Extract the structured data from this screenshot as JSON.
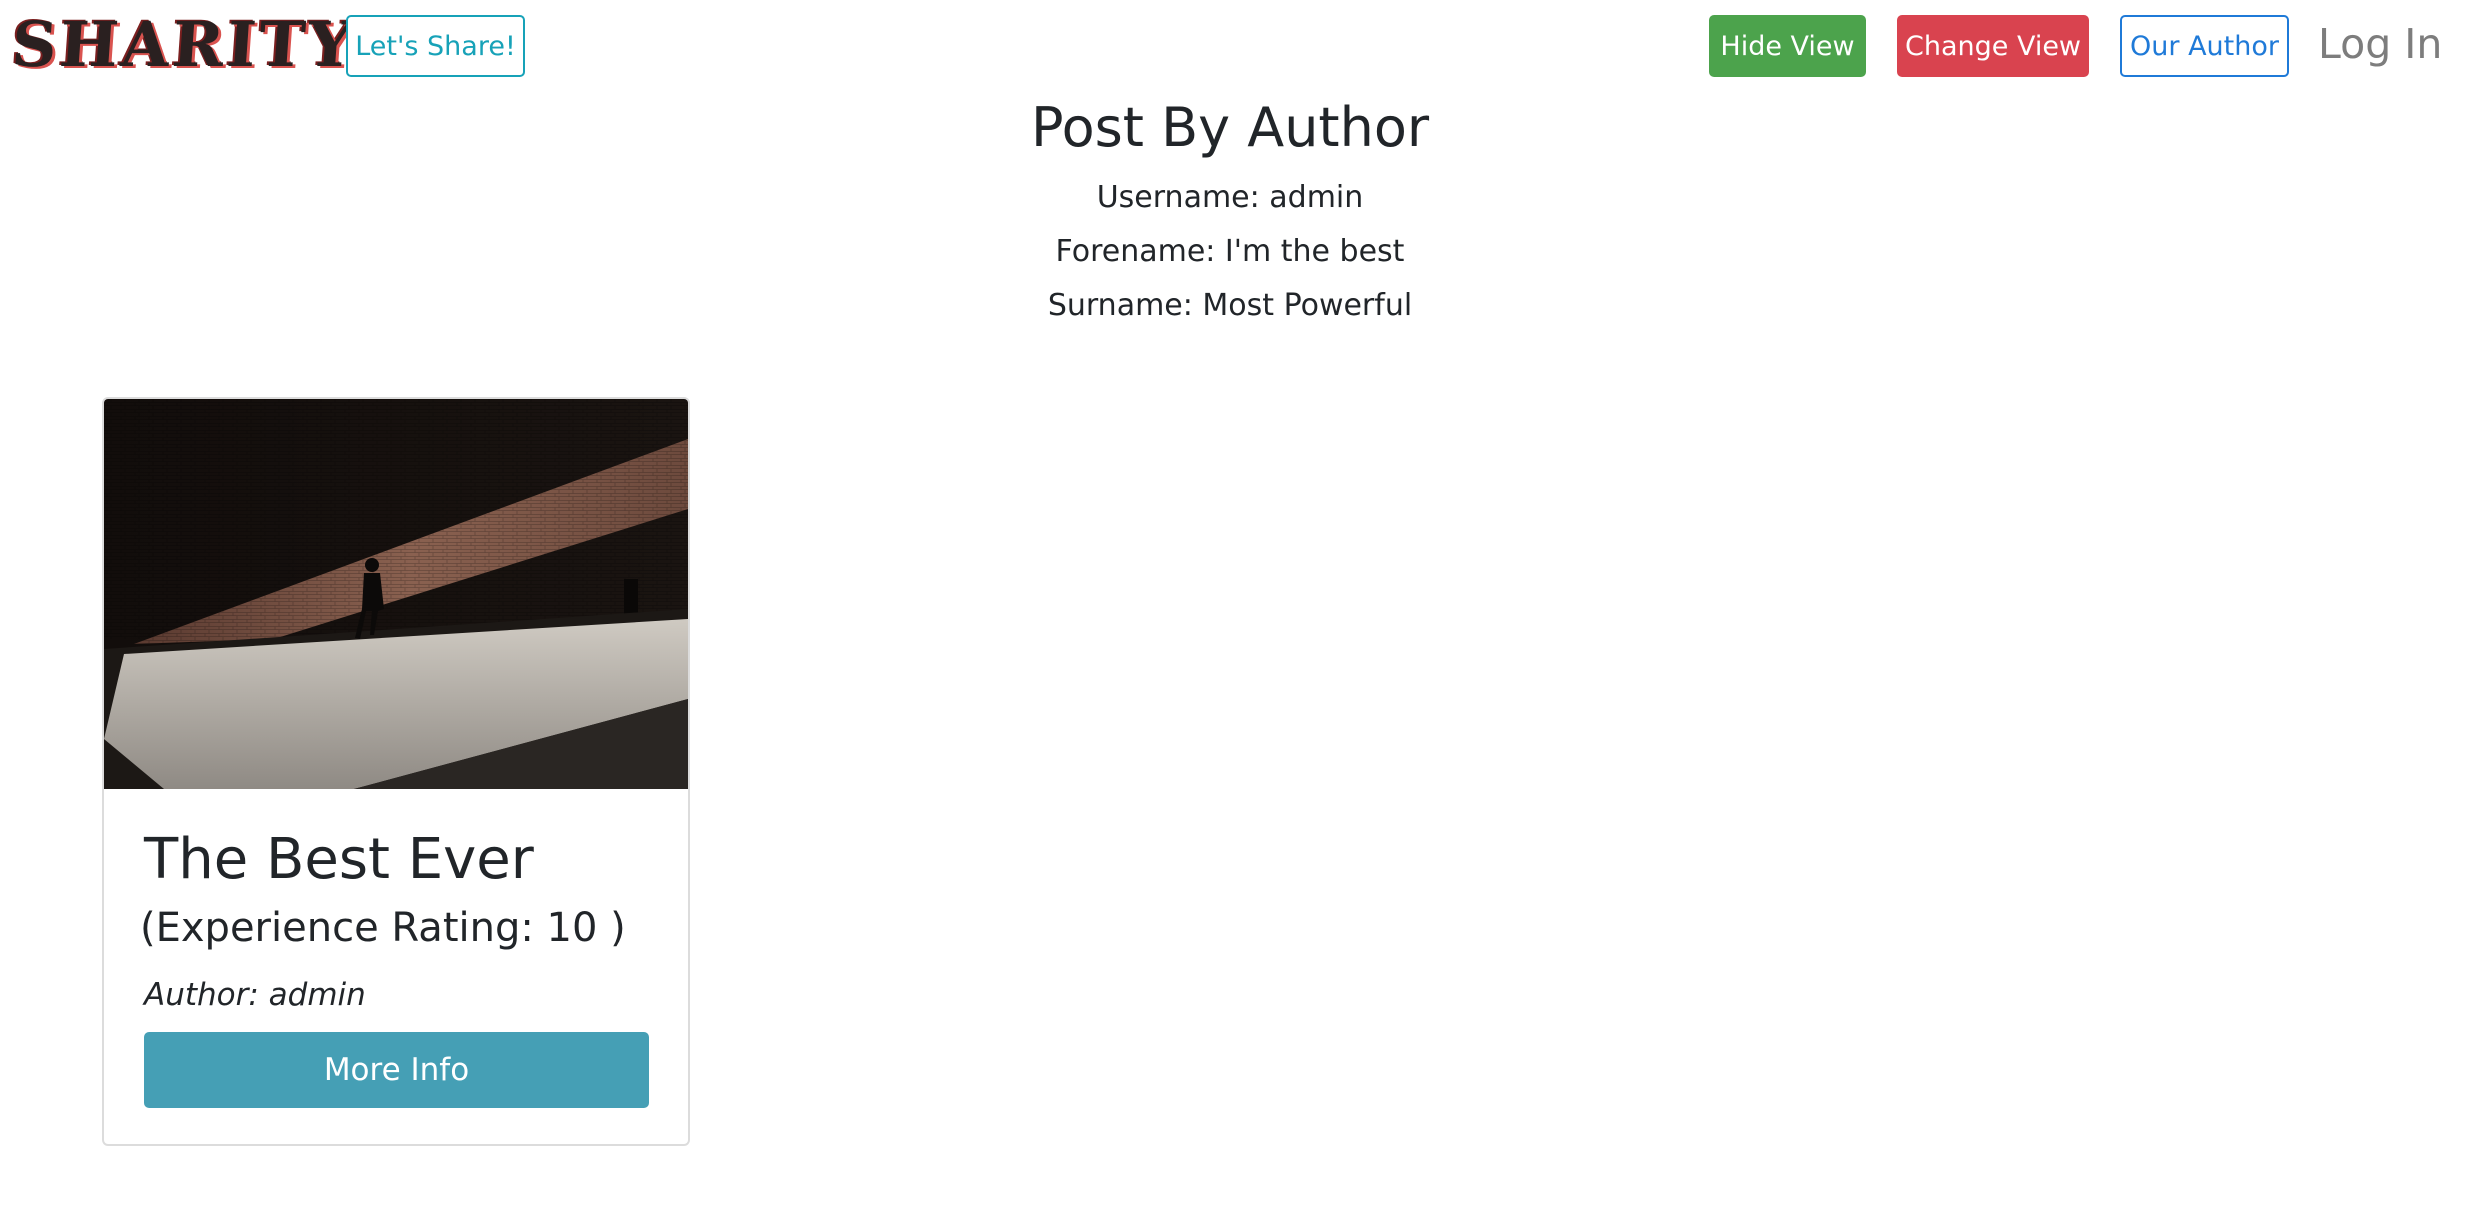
{
  "navbar": {
    "logo_text": "SHARITY",
    "share_label": "Let's Share!",
    "hide_view_label": "Hide View",
    "change_view_label": "Change View",
    "our_author_label": "Our Author",
    "login_label": "Log In"
  },
  "author": {
    "title": "Post By Author",
    "username_line": "Username: admin",
    "forename_line": "Forename: I'm the best",
    "surname_line": "Surname: Most Powerful"
  },
  "posts": [
    {
      "title": "The Best Ever",
      "rating_text": "(Experience Rating: 10 )",
      "author_text": "Author: admin",
      "more_info_label": "More Info",
      "image_alt": "photo-street-shadow"
    }
  ],
  "colors": {
    "share_outline": "#17a2b8",
    "hide_view_bg": "#4ca34c",
    "change_view_bg": "#d9434f",
    "our_author_outline": "#1f7ad8",
    "more_info_bg": "#459fb5"
  }
}
